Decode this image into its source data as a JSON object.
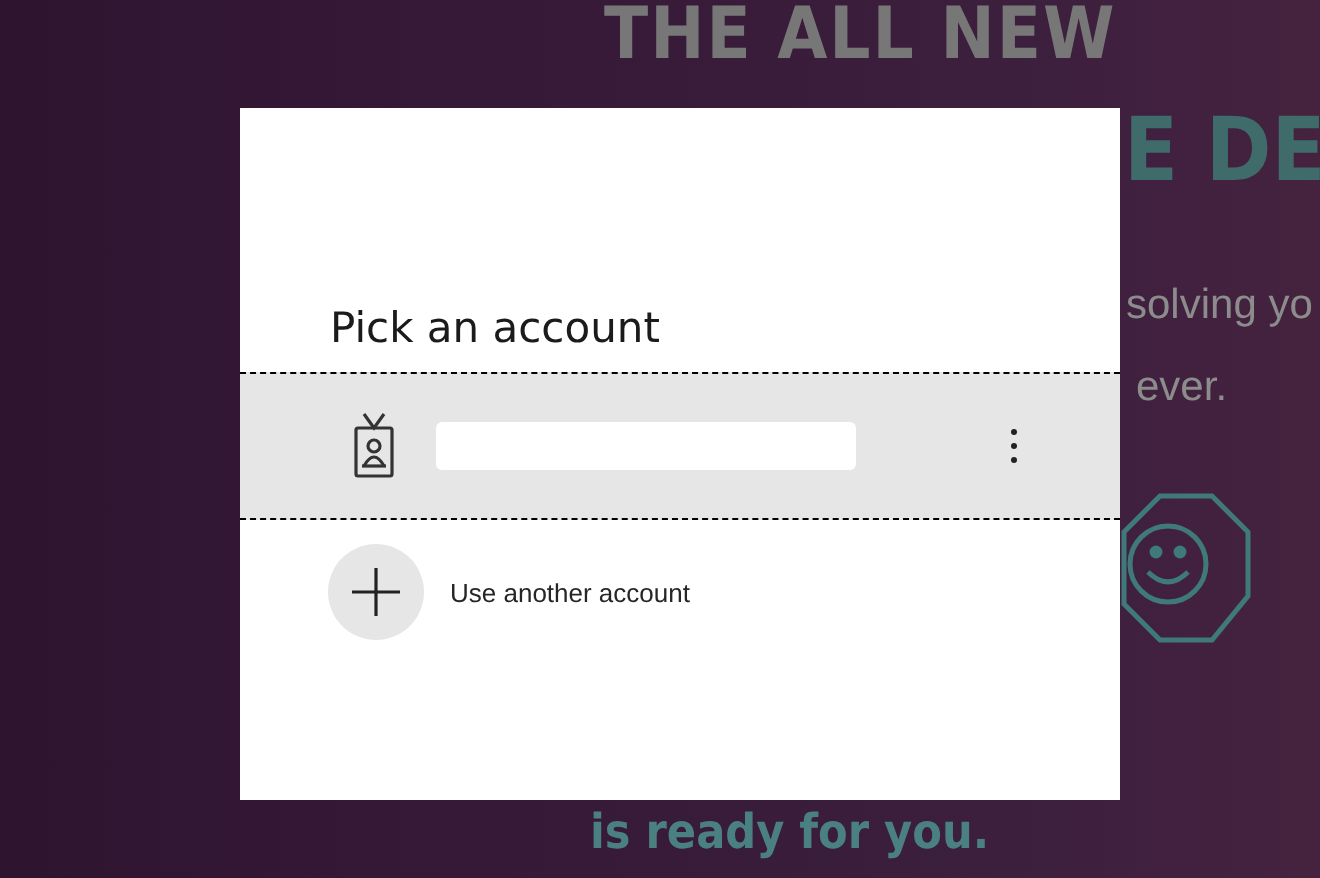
{
  "background": {
    "headline": "THE ALL NEW",
    "subheadline": "E DE",
    "tagline_1": "solving yo",
    "tagline_2": "ever.",
    "footer_line": "is ready for you."
  },
  "dialog": {
    "title": "Pick an account",
    "accounts": [
      {
        "selected": true
      }
    ],
    "add_account": {
      "label": "Use another account"
    }
  }
}
